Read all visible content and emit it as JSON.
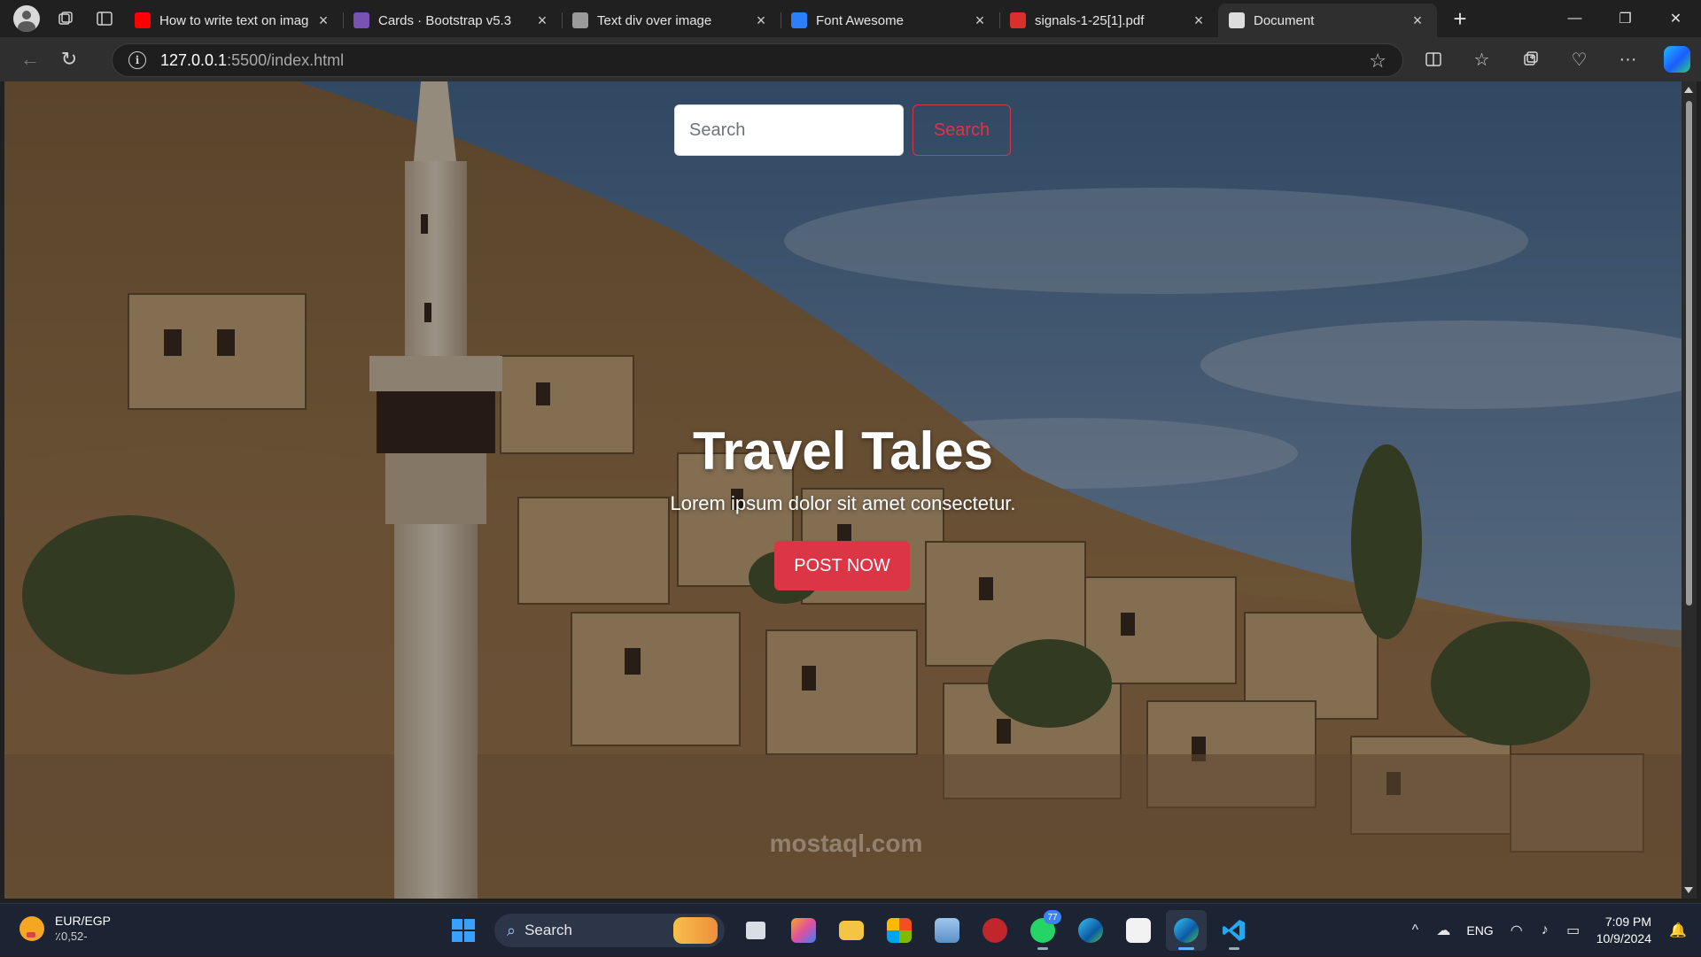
{
  "browser": {
    "tabs": [
      {
        "title": "How to write text on imag",
        "favicon": "youtube-icon",
        "color": "#ff0000"
      },
      {
        "title": "Cards · Bootstrap v5.3",
        "favicon": "bootstrap-icon",
        "color": "#7952b3"
      },
      {
        "title": "Text div over image",
        "favicon": "chatgpt-icon",
        "color": "#9a9a9a"
      },
      {
        "title": "Font Awesome",
        "favicon": "font-awesome-flag-icon",
        "color": "#2d7ff9"
      },
      {
        "title": "signals-1-25[1].pdf",
        "favicon": "pdf-icon",
        "color": "#d9302c"
      },
      {
        "title": "Document",
        "favicon": "document-icon",
        "color": "#dddddd"
      }
    ],
    "active_tab_index": 5,
    "address": {
      "host": "127.0.0.1",
      "path": ":5500/index.html"
    }
  },
  "page": {
    "search": {
      "placeholder": "Search",
      "button_label": "Search"
    },
    "hero": {
      "title": "Travel Tales",
      "subtitle": "Lorem ipsum dolor sit amet consectetur.",
      "cta_label": "POST NOW"
    },
    "watermark": "mostaql.com",
    "colors": {
      "accent": "#dc3545",
      "input_bg": "#ffffff"
    }
  },
  "taskbar": {
    "weather": {
      "pair": "EUR/EGP",
      "value": "٪0,52-"
    },
    "search_label": "Search",
    "whatsapp_badge": "77",
    "language": "ENG",
    "time": "7:09 PM",
    "date": "10/9/2024"
  }
}
